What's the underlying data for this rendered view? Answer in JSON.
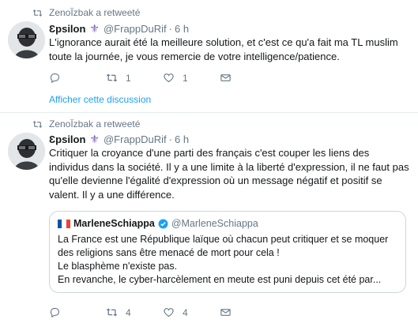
{
  "tweets": [
    {
      "retweet_text": "ZenoÏzbak a retweeté",
      "name": "Ɛpsilon",
      "badge": "⚜",
      "handle": "@FrappDuRif",
      "separator": "·",
      "time": "6 h",
      "text": "L'ignorance aurait été la meilleure solution, et c'est ce qu'a fait ma TL muslim toute la journée, je vous remercie de votre intelligence/patience.",
      "reply_count": "",
      "retweet_count": "1",
      "like_count": "1",
      "show_thread": "Afficher cette discussion"
    },
    {
      "retweet_text": "ZenoÏzbak a retweeté",
      "name": "Ɛpsilon",
      "badge": "⚜",
      "handle": "@FrappDuRif",
      "separator": "·",
      "time": "6 h",
      "text": "Critiquer la croyance d'une parti des français c'est couper les liens des individus dans la société. Il y a une limite à la liberté d'expression, il ne faut pas qu'elle devienne l'égalité d'expression où un message négatif et positif se valent. Il y a une différence.",
      "reply_count": "",
      "retweet_count": "4",
      "like_count": "4",
      "quote": {
        "name": "MarleneSchiappa",
        "handle": "@MarleneSchiappa",
        "lines": [
          "La France est une République laïque où chacun peut critiquer et se moquer",
          "des religions sans être menacé de mort pour cela !",
          "Le blasphème n'existe pas.",
          "En revanche, le cyber-harcèlement en meute est puni depuis cet été par..."
        ]
      }
    }
  ],
  "colors": {
    "accent": "#1da1f2",
    "secondary_text": "#657786",
    "divider": "#e6ecf0",
    "badge": "#7b5fb3",
    "verified": "#1da1f2"
  },
  "icons": {
    "retweet_indicator": "retweet-icon",
    "reply": "reply-icon",
    "retweet": "retweet-icon",
    "like": "heart-icon",
    "dm": "envelope-icon"
  }
}
